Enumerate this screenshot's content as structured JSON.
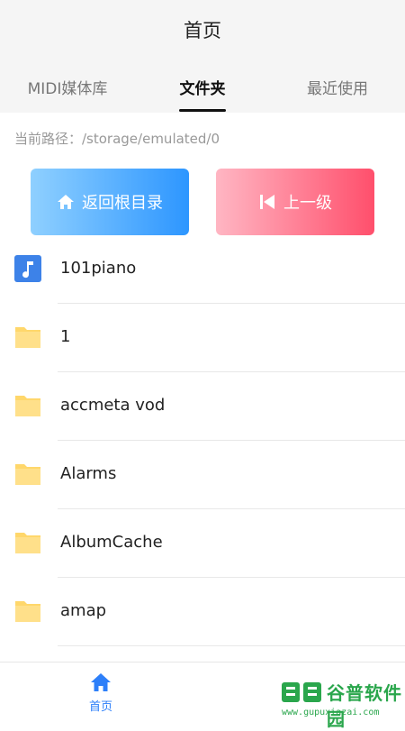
{
  "header": {
    "title": "首页",
    "tabs": [
      {
        "label": "MIDI媒体库"
      },
      {
        "label": "文件夹"
      },
      {
        "label": "最近使用"
      }
    ],
    "active_tab": "文件夹"
  },
  "path": {
    "text": "当前路径：/storage/emulated/0"
  },
  "buttons": {
    "root_label": "返回根目录",
    "up_label": "上一级",
    "root_icon": "home-icon",
    "up_icon": "skip-previous-icon"
  },
  "files": [
    {
      "name": "101piano",
      "icon": "music-file-icon"
    },
    {
      "name": "1",
      "icon": "folder-icon"
    },
    {
      "name": "accmeta vod",
      "icon": "folder-icon"
    },
    {
      "name": "Alarms",
      "icon": "folder-icon"
    },
    {
      "name": "AlbumCache",
      "icon": "folder-icon"
    },
    {
      "name": "amap",
      "icon": "folder-icon"
    }
  ],
  "bottom_nav": {
    "home_label": "首页",
    "home_icon": "home-icon"
  },
  "watermark": {
    "text": "谷普软件园",
    "url": "www.gupuxiazai.com"
  },
  "colors": {
    "accent_blue": "#2d7ff9",
    "root_button_start": "#8fd0ff",
    "root_button_end": "#2d96ff",
    "up_button_start": "#ffb6c3",
    "up_button_end": "#ff4f6c",
    "folder_yellow": "#ffd76b",
    "music_icon_blue": "#3d82e8"
  }
}
